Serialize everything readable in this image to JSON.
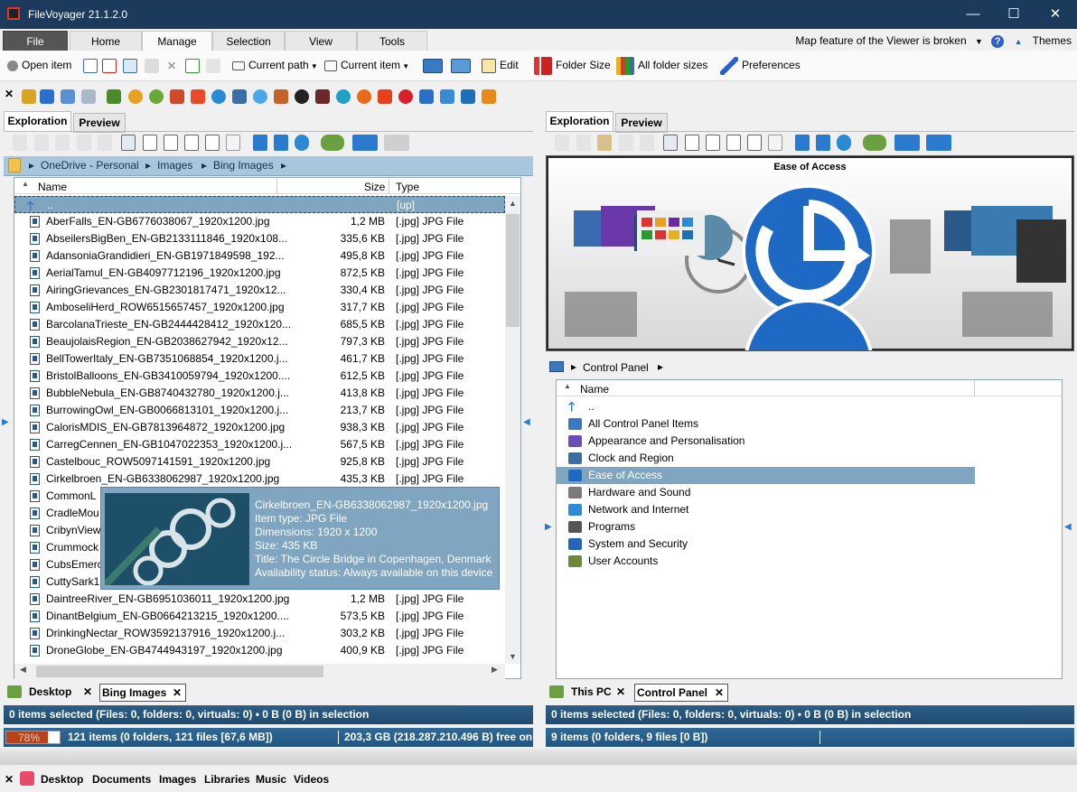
{
  "window": {
    "title": "FileVoyager 21.1.2.0",
    "minimize": "—",
    "maximize": "☐",
    "close": "✕"
  },
  "ribbon": {
    "tabs": [
      "File",
      "Home",
      "Manage",
      "Selection",
      "View",
      "Tools"
    ],
    "active_tab": "Manage",
    "notice": "Map feature of the Viewer is broken",
    "help": "?",
    "themes": "Themes"
  },
  "toolbar": {
    "open_item": "Open item",
    "current_path": "Current path",
    "current_item": "Current item",
    "edit": "Edit",
    "folder_size": "Folder Size",
    "all_folder_sizes": "All folder sizes",
    "preferences": "Preferences"
  },
  "left": {
    "tabs": [
      "Exploration",
      "Preview"
    ],
    "breadcrumb": [
      "OneDrive - Personal",
      "Images",
      "Bing Images"
    ],
    "headers": {
      "name": "Name",
      "size": "Size",
      "type": "Type"
    },
    "up_row": {
      "name": "..",
      "type": "[up]"
    },
    "files": [
      {
        "name": "AberFalls_EN-GB6776038067_1920x1200.jpg",
        "size": "1,2 MB",
        "type": "[.jpg]  JPG File"
      },
      {
        "name": "AbseilersBigBen_EN-GB2133111846_1920x108...",
        "size": "335,6 KB",
        "type": "[.jpg]  JPG File"
      },
      {
        "name": "AdansoniaGrandidieri_EN-GB1971849598_192...",
        "size": "495,8 KB",
        "type": "[.jpg]  JPG File"
      },
      {
        "name": "AerialTamul_EN-GB4097712196_1920x1200.jpg",
        "size": "872,5 KB",
        "type": "[.jpg]  JPG File"
      },
      {
        "name": "AiringGrievances_EN-GB2301817471_1920x12...",
        "size": "330,4 KB",
        "type": "[.jpg]  JPG File"
      },
      {
        "name": "AmboseliHerd_ROW6515657457_1920x1200.jpg",
        "size": "317,7 KB",
        "type": "[.jpg]  JPG File"
      },
      {
        "name": "BarcolanaTrieste_EN-GB2444428412_1920x120...",
        "size": "685,5 KB",
        "type": "[.jpg]  JPG File"
      },
      {
        "name": "BeaujolaisRegion_EN-GB2038627942_1920x12...",
        "size": "797,3 KB",
        "type": "[.jpg]  JPG File"
      },
      {
        "name": "BellTowerItaly_EN-GB7351068854_1920x1200.j...",
        "size": "461,7 KB",
        "type": "[.jpg]  JPG File"
      },
      {
        "name": "BristolBalloons_EN-GB3410059794_1920x1200....",
        "size": "612,5 KB",
        "type": "[.jpg]  JPG File"
      },
      {
        "name": "BubbleNebula_EN-GB8740432780_1920x1200.j...",
        "size": "413,8 KB",
        "type": "[.jpg]  JPG File"
      },
      {
        "name": "BurrowingOwl_EN-GB0066813101_1920x1200.j...",
        "size": "213,7 KB",
        "type": "[.jpg]  JPG File"
      },
      {
        "name": "CalorisMDIS_EN-GB7813964872_1920x1200.jpg",
        "size": "938,3 KB",
        "type": "[.jpg]  JPG File"
      },
      {
        "name": "CarregCennen_EN-GB1047022353_1920x1200.j...",
        "size": "567,5 KB",
        "type": "[.jpg]  JPG File"
      },
      {
        "name": "Castelbouc_ROW5097141591_1920x1200.jpg",
        "size": "925,8 KB",
        "type": "[.jpg]  JPG File"
      },
      {
        "name": "Cirkelbroen_EN-GB6338062987_1920x1200.jpg",
        "size": "435,3 KB",
        "type": "[.jpg]  JPG File"
      },
      {
        "name": "CommonL",
        "size": "",
        "type": ""
      },
      {
        "name": "CradleMou",
        "size": "",
        "type": ""
      },
      {
        "name": "CribynView",
        "size": "",
        "type": ""
      },
      {
        "name": "Crummock",
        "size": "",
        "type": ""
      },
      {
        "name": "CubsEmerc",
        "size": "",
        "type": ""
      },
      {
        "name": "CuttySark1",
        "size": "",
        "type": ""
      },
      {
        "name": "DaintreeRiver_EN-GB6951036011_1920x1200.jpg",
        "size": "1,2 MB",
        "type": "[.jpg]  JPG File"
      },
      {
        "name": "DinantBelgium_EN-GB0664213215_1920x1200....",
        "size": "573,5 KB",
        "type": "[.jpg]  JPG File"
      },
      {
        "name": "DrinkingNectar_ROW3592137916_1920x1200.j...",
        "size": "303,2 KB",
        "type": "[.jpg]  JPG File"
      },
      {
        "name": "DroneGlobe_EN-GB4744943197_1920x1200.jpg",
        "size": "400,9 KB",
        "type": "[.jpg]  JPG File"
      }
    ],
    "tooltip": [
      "Cirkelbroen_EN-GB6338062987_1920x1200.jpg",
      "Item type: JPG File",
      "Dimensions: 1920 x 1200",
      "Size: 435 KB",
      "Title: The Circle Bridge in Copenhagen, Denmark",
      "Availability status: Always available on this device"
    ],
    "bottom_tabs": [
      "Desktop",
      "Bing Images"
    ],
    "status_selection": "0 items selected (Files: 0, folders: 0, virtuals: 0) • 0 B (0 B) in selection",
    "disk_percent_label": "78%",
    "disk_fraction": 0.78,
    "status_items": "121 items (0 folders, 121 files [67,6 MB])",
    "status_free": "203,3 GB (218.287.210.496 B) free on"
  },
  "right": {
    "tabs": [
      "Exploration",
      "Preview"
    ],
    "preview_title": "Ease of Access",
    "breadcrumb": [
      "Control Panel"
    ],
    "headers": {
      "name": "Name"
    },
    "up_row": "..",
    "items": [
      {
        "name": "All Control Panel Items",
        "color": "#3a78c2"
      },
      {
        "name": "Appearance and Personalisation",
        "color": "#6b4fb3"
      },
      {
        "name": "Clock and Region",
        "color": "#3a6ea5"
      },
      {
        "name": "Ease of Access",
        "color": "#1d69c4"
      },
      {
        "name": "Hardware and Sound",
        "color": "#7a7a7a"
      },
      {
        "name": "Network and Internet",
        "color": "#2e8ad6"
      },
      {
        "name": "Programs",
        "color": "#555555"
      },
      {
        "name": "System and Security",
        "color": "#2266b8"
      },
      {
        "name": "User Accounts",
        "color": "#6a8a3a"
      }
    ],
    "selected": "Ease of Access",
    "bottom_tabs": [
      "This PC",
      "Control Panel"
    ],
    "status_selection": "0 items selected (Files: 0, folders: 0, virtuals: 0) • 0 B (0 B) in selection",
    "status_items": "9 items (0 folders, 9 files [0 B])"
  },
  "favorites": [
    "Desktop",
    "Documents",
    "Images",
    "Libraries",
    "Music",
    "Videos"
  ],
  "colors": {
    "titlebar": "#1b3a5c",
    "selection": "#7fa5c0",
    "breadcrumb": "#a9c7dc"
  }
}
